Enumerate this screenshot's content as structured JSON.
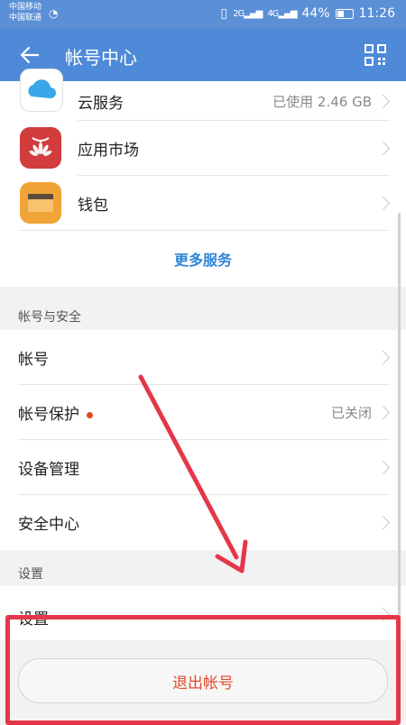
{
  "status_bar": {
    "carrier1": "中国移动",
    "carrier2": "中国联通",
    "network_left": "2G",
    "network_right": "4G",
    "battery": "44%",
    "time": "11:26"
  },
  "header": {
    "title": "帐号中心"
  },
  "services": [
    {
      "label": "云服务",
      "value": "已使用 2.46 GB",
      "icon": "cloud-icon",
      "color": "#38a6e8"
    },
    {
      "label": "应用市场",
      "value": "",
      "icon": "huawei-appstore-icon",
      "color": "#d23c3c"
    },
    {
      "label": "钱包",
      "value": "",
      "icon": "wallet-icon",
      "color": "#f0a336"
    }
  ],
  "more_services": "更多服务",
  "account_section": {
    "title": "帐号与安全",
    "items": [
      {
        "label": "帐号",
        "value": ""
      },
      {
        "label": "帐号保护",
        "value": "已关闭"
      },
      {
        "label": "设备管理",
        "value": ""
      },
      {
        "label": "安全中心",
        "value": ""
      }
    ]
  },
  "settings_section": {
    "title": "设置",
    "items": [
      {
        "label": "设置"
      }
    ]
  },
  "logout_label": "退出帐号",
  "colors": {
    "accent": "#4f8ad8",
    "link": "#2d84d8",
    "danger": "#e24a2b",
    "annotation": "#e5374a"
  }
}
